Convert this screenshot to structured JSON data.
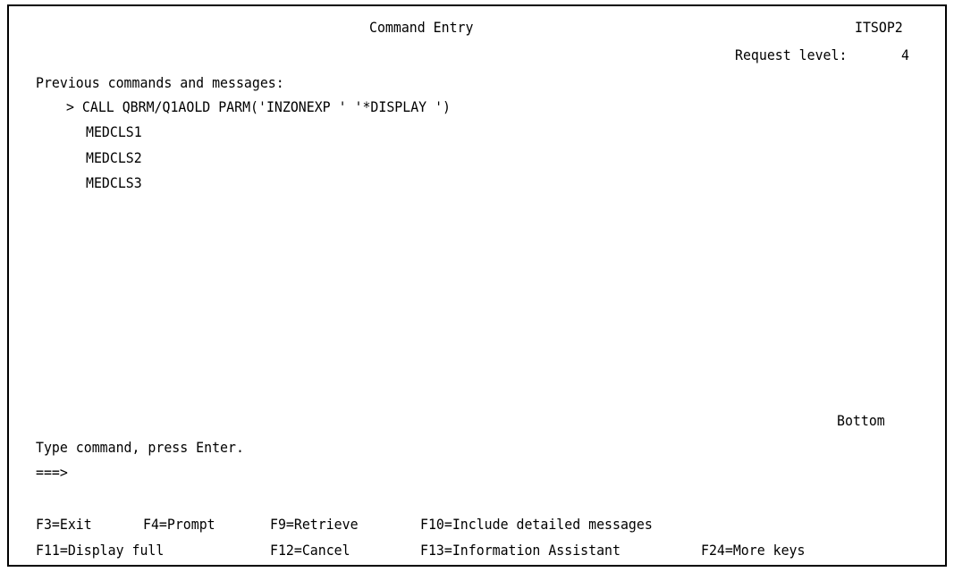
{
  "header": {
    "title": "Command Entry",
    "system_name": "ITSOP2",
    "request_level_label": "Request level:",
    "request_level_value": "4"
  },
  "messages": {
    "heading": "Previous commands and messages:",
    "lines": [
      "> CALL QBRM/Q1AOLD PARM('INZONEXP ' '*DISPLAY ')",
      "MEDCLS1",
      "MEDCLS2",
      "MEDCLS3"
    ],
    "position_indicator": "Bottom"
  },
  "command": {
    "instruction": "Type command, press Enter.",
    "prompt": "===>",
    "value": ""
  },
  "function_keys": {
    "row1": [
      "F3=Exit",
      "F4=Prompt",
      "F9=Retrieve",
      "F10=Include detailed messages"
    ],
    "row2": [
      "F11=Display full",
      "F12=Cancel",
      "F13=Information Assistant",
      "F24=More keys"
    ]
  }
}
